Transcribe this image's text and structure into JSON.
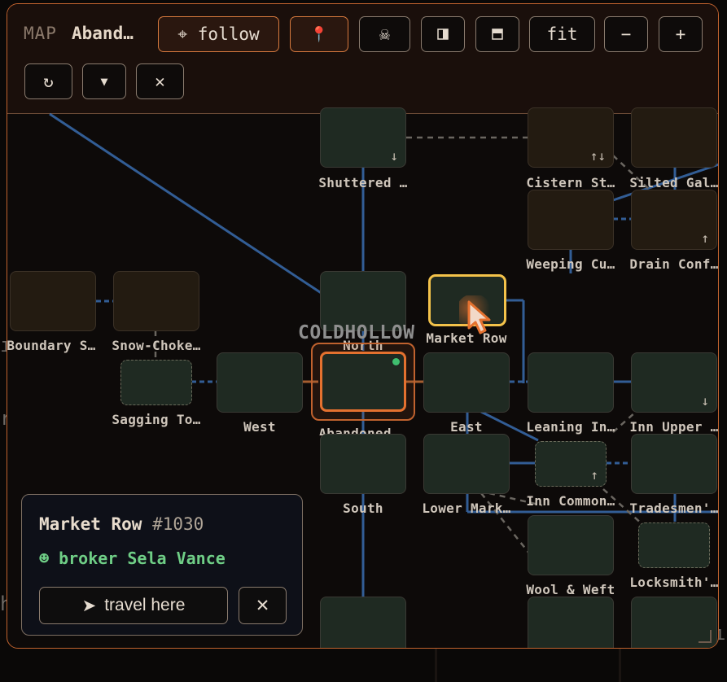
{
  "window": {
    "label": "MAP",
    "title": "Aband…"
  },
  "toolbar": {
    "follow_label": "⌖ follow",
    "pin_icon": "📍",
    "skull_icon": "☠",
    "fit_label": "fit",
    "zoom_out_label": "−",
    "zoom_in_label": "+",
    "rotate_icon": "↻",
    "collapse_icon": "▼",
    "close_icon": "✕"
  },
  "map": {
    "region_label": "COLDHOLLOW",
    "rooms": {
      "shuttered": {
        "label": "Shuttered …",
        "arrow": "↓"
      },
      "cistern": {
        "label": "Cistern St…",
        "arrow": "↑↓"
      },
      "silted": {
        "label": "Silted Gal…"
      },
      "weeping": {
        "label": "Weeping Cu…"
      },
      "drain": {
        "label": "Drain Conf…",
        "arrow": "↑"
      },
      "boundary": {
        "label": "Boundary S…"
      },
      "snowchoked": {
        "label": "Snow-Choke…"
      },
      "north": {
        "label": "North"
      },
      "market_row": {
        "label": "Market Row"
      },
      "sagging": {
        "label": "Sagging To…"
      },
      "west": {
        "label": "West"
      },
      "abandoned": {
        "label": "Abandoned …"
      },
      "east": {
        "label": "East"
      },
      "leaning": {
        "label": "Leaning In…"
      },
      "inn_upper": {
        "label": "Inn Upper …",
        "arrow": "↓"
      },
      "south": {
        "label": "South"
      },
      "lower_market": {
        "label": "Lower Mark…"
      },
      "inn_common": {
        "label": "Inn Common…",
        "arrow": "↑"
      },
      "tradesmen": {
        "label": "Tradesmen'…"
      },
      "wool_weft": {
        "label": "Wool & Weft"
      },
      "locksmith": {
        "label": "Locksmith'…"
      }
    }
  },
  "popup": {
    "room_name": "Market Row",
    "room_id": "#1030",
    "npc": "☻ broker Sela Vance",
    "travel_label": "travel here",
    "travel_icon": "➤",
    "close_icon": "✕"
  },
  "colors": {
    "accent": "#e4712f",
    "selected": "#f3c24a",
    "npc": "#6fce86",
    "edge_solid": "#3f79c4",
    "edge_dashed": "#6a6660"
  }
}
